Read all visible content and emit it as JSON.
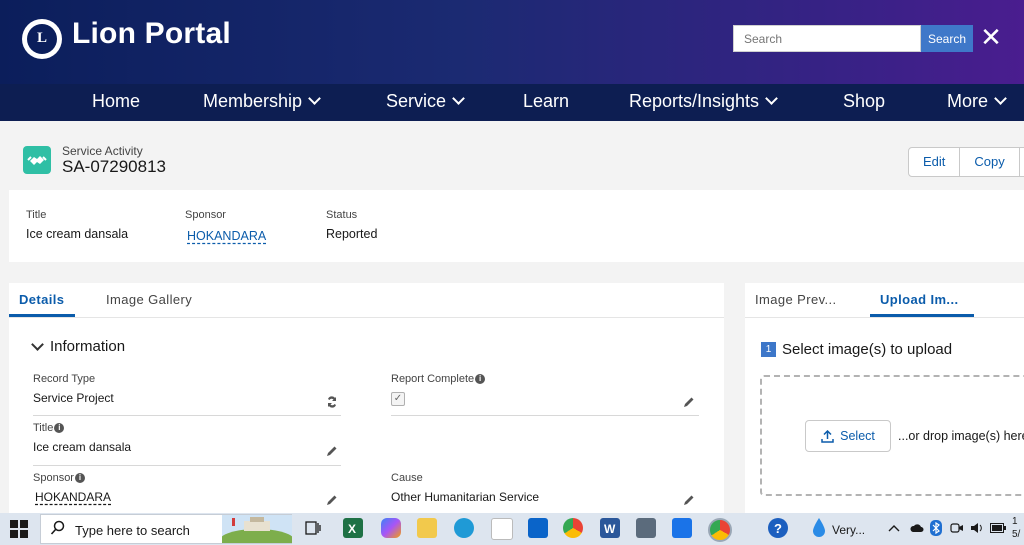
{
  "header": {
    "brand": "Lion Portal",
    "logo_icon": "lions-club-emblem-icon",
    "search_placeholder": "Search",
    "search_button": "Search"
  },
  "nav": {
    "items": [
      {
        "label": "Home",
        "dropdown": false
      },
      {
        "label": "Membership",
        "dropdown": true
      },
      {
        "label": "Service",
        "dropdown": true
      },
      {
        "label": "Learn",
        "dropdown": false
      },
      {
        "label": "Reports/Insights",
        "dropdown": true
      },
      {
        "label": "Shop",
        "dropdown": false
      },
      {
        "label": "More",
        "dropdown": true
      }
    ]
  },
  "record": {
    "object_type": "Service Activity",
    "id": "SA-07290813",
    "actions": [
      "Edit",
      "Copy"
    ]
  },
  "highlights": {
    "title_label": "Title",
    "title_value": "Ice cream dansala",
    "sponsor_label": "Sponsor",
    "sponsor_value": "HOKANDARA",
    "status_label": "Status",
    "status_value": "Reported"
  },
  "details": {
    "tabs": [
      "Details",
      "Image Gallery"
    ],
    "active_tab": "Details",
    "section_title": "Information",
    "fields": {
      "record_type_label": "Record Type",
      "record_type_value": "Service Project",
      "report_complete_label": "Report Complete",
      "report_complete_checked": true,
      "title_label": "Title",
      "title_value": "Ice cream dansala",
      "sponsor_label": "Sponsor",
      "sponsor_value": "HOKANDARA",
      "cause_label": "Cause",
      "cause_value": "Other Humanitarian Service"
    }
  },
  "upload": {
    "tabs": [
      "Image Prev...",
      "Upload Im..."
    ],
    "active_tab": "Upload Im...",
    "step_number": "1",
    "title": "Select image(s) to upload",
    "select_button": "Select",
    "drop_text": "...or drop image(s) here"
  },
  "taskbar": {
    "search_placeholder": "Type here to search",
    "tray_weather": "Very...",
    "clock_line1": "1",
    "clock_line2": "5/"
  },
  "colors": {
    "header_gradient_start": "#0b1e5b",
    "header_gradient_end": "#4a1d8f",
    "nav_bg": "#0d1e52",
    "accent_blue": "#0b5cab",
    "search_button_bg": "#3f78c9",
    "record_icon_bg": "#2fbfa5"
  }
}
